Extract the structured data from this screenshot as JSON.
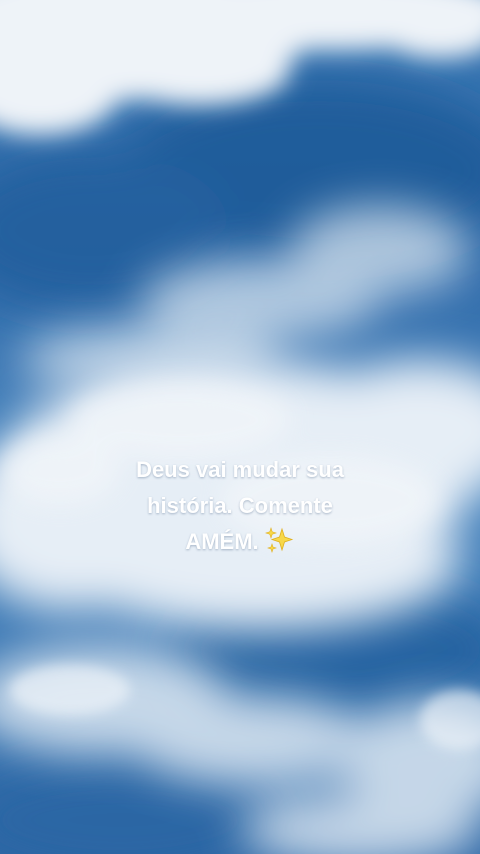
{
  "caption": {
    "lines": [
      "Deus vai mudar sua",
      "história. Comente",
      "AMÉM."
    ],
    "emoji_icon": "sparkles-icon"
  },
  "colors": {
    "sky_blue": "#2f6aa9",
    "cloud_white": "#e9eff5",
    "text": "#ffffff",
    "sparkle": "#f7d84a"
  }
}
